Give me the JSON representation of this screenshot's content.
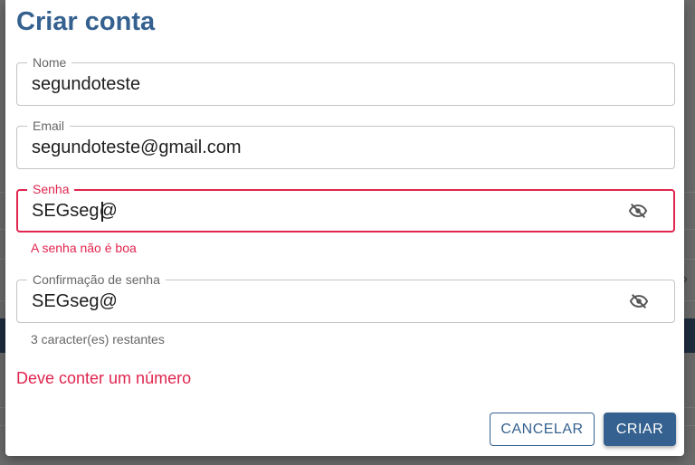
{
  "dialog": {
    "title": "Criar conta",
    "fields": {
      "name": {
        "label": "Nome",
        "value": "segundoteste"
      },
      "email": {
        "label": "Email",
        "value": "segundoteste@gmail.com"
      },
      "password": {
        "label": "Senha",
        "value": "SEGseg@",
        "error": "A senha não é boa",
        "icon": "eye-off-icon"
      },
      "confirm": {
        "label": "Confirmação de senha",
        "value": "SEGseg@",
        "helper": "3 caracter(es) restantes",
        "icon": "eye-off-icon"
      }
    },
    "rule_error": "Deve conter um número",
    "buttons": {
      "cancel": "CANCELAR",
      "create": "CRIAR"
    }
  },
  "colors": {
    "primary": "#34618f",
    "error": "#e0254f",
    "muted": "#666666",
    "border": "#c4c4c4"
  }
}
